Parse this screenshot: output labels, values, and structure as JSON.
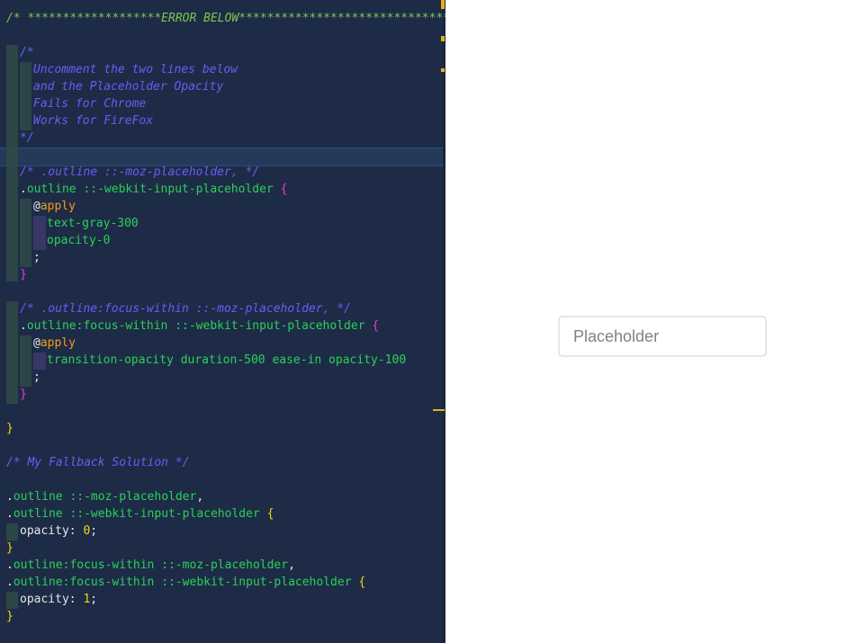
{
  "editor": {
    "lines": {
      "l1": "/* *******************ERROR BELOW*******************************",
      "l3": "/*",
      "l4": "Uncomment the two lines below",
      "l5": "and the Placeholder Opacity",
      "l6": "Fails for Chrome",
      "l7": "Works for FireFox",
      "l8": "*/",
      "l10": "/* .outline ::-moz-placeholder, */",
      "l11_dot": ".",
      "l11_cls": "outline",
      "l11_sel": " ::-webkit-input-placeholder ",
      "l11_brace": "{",
      "l12_at": "@",
      "l12_apply": "apply",
      "l13": "text-gray-300",
      "l14": "opacity-0",
      "l15": ";",
      "l16": "}",
      "l18": "/* .outline:focus-within ::-moz-placeholder, */",
      "l19_dot": ".",
      "l19_cls": "outline",
      "l19_sel": ":focus-within ::-webkit-input-placeholder ",
      "l19_brace": "{",
      "l20_at": "@",
      "l20_apply": "apply",
      "l21": "transition-opacity duration-500 ease-in opacity-100",
      "l22": ";",
      "l23": "}",
      "l25": "}",
      "l27": "/* My Fallback Solution */",
      "l29_dot": ".",
      "l29_cls": "outline",
      "l29_sel": " ::-moz-placeholder",
      "l29_punc": ",",
      "l30_dot": ".",
      "l30_cls": "outline",
      "l30_sel": " ::-webkit-input-placeholder ",
      "l30_brace": "{",
      "l31_prop": "opacity",
      "l31_colon": ": ",
      "l31_num": "0",
      "l31_semi": ";",
      "l32": "}",
      "l33_dot": ".",
      "l33_cls": "outline",
      "l33_sel": ":focus-within ::-moz-placeholder",
      "l33_punc": ",",
      "l34_dot": ".",
      "l34_cls": "outline",
      "l34_sel": ":focus-within ::-webkit-input-placeholder ",
      "l34_brace": "{",
      "l35_prop": "opacity",
      "l35_colon": ": ",
      "l35_num": "1",
      "l35_semi": ";",
      "l36": "}"
    }
  },
  "preview": {
    "input_placeholder": "Placeholder"
  },
  "colors": {
    "editor_bg": "#1e2b47",
    "comment": "#6a5cf5",
    "header_comment": "#7ac74f",
    "selector": "#2ad158",
    "brace": "#f2d90f",
    "pink_brace": "#f236c6",
    "apply": "#f29d1a",
    "marker": "#e3b21a"
  }
}
